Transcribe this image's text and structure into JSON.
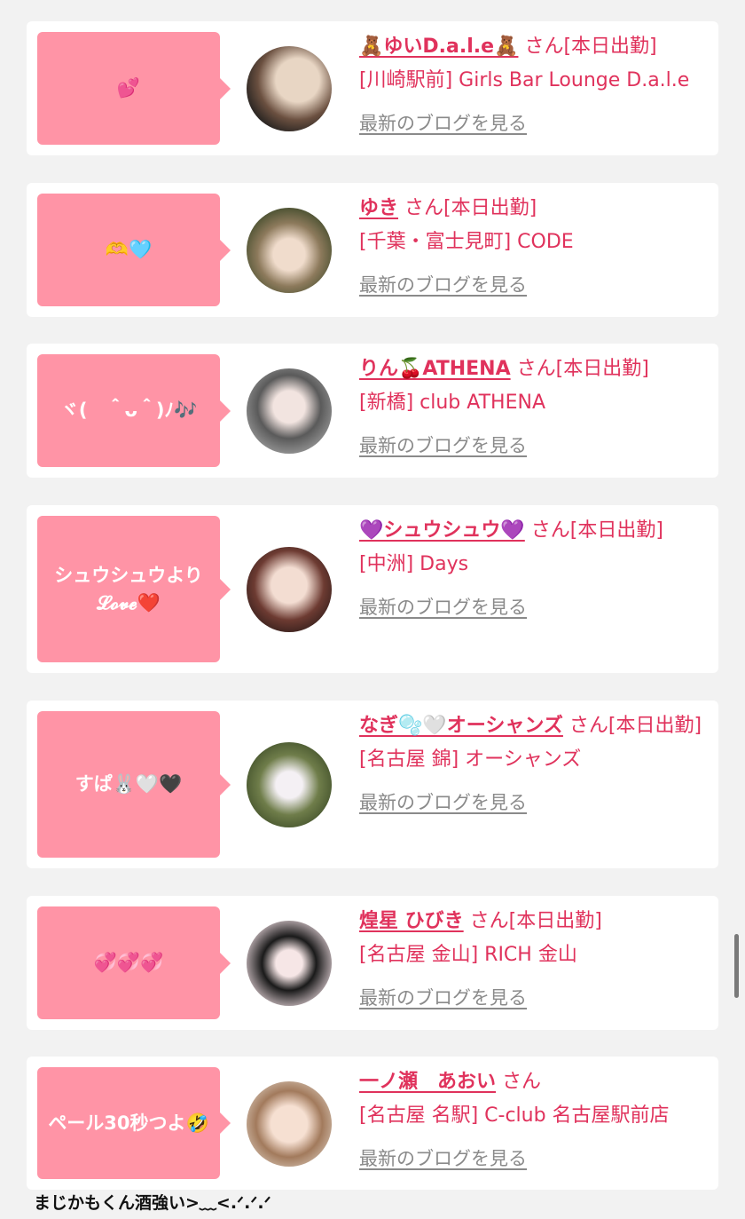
{
  "cards": [
    {
      "bubble": "💕",
      "name": "🧸ゆいD.a.l.e🧸",
      "san": "さん[本日出勤]",
      "shop": "[川崎駅前] Girls Bar Lounge D.a.l.e",
      "blog": "最新のブログを見る"
    },
    {
      "bubble": "🫶🩵",
      "name": "ゆき",
      "san": "さん[本日出勤]",
      "shop": "[千葉・富士見町] CODE",
      "blog": "最新のブログを見る"
    },
    {
      "bubble": "ヾ(　＾ᴗ＾)ﾉ🎶",
      "name": "りん🍒ATHENA",
      "san": "さん[本日出勤]",
      "shop": "[新橋] club ATHENA",
      "blog": "最新のブログを見る"
    },
    {
      "bubble": "シュウシュウより𝓛𝓸𝓿𝓮❤️",
      "name": "💜シュウシュウ💜",
      "san": "さん[本日出勤]",
      "shop": "[中洲] Days",
      "blog": "最新のブログを見る"
    },
    {
      "bubble": "すぱ🐰🤍🖤",
      "name": "なぎ🫧🤍オーシャンズ",
      "san": "さん[本日出勤]",
      "shop": "[名古屋 錦] オーシャンズ",
      "blog": "最新のブログを見る"
    },
    {
      "bubble": "💞💞💞",
      "name": "煌星 ひびき",
      "san": "さん[本日出勤]",
      "shop": "[名古屋 金山] RICH 金山",
      "blog": "最新のブログを見る"
    },
    {
      "bubble": "ペール30秒つよ🤣",
      "name": "一ノ瀬　あおい",
      "san": "さん",
      "shop": "[名古屋 名駅] C-club 名古屋駅前店",
      "blog": "最新のブログを見る"
    }
  ],
  "caption": "まじかもくん酒強い>﹏<.ᐟ.ᐟ.ᐟ",
  "colors": {
    "accent": "#e0325c",
    "bubble": "#ff94a6",
    "link_gray": "#8a8a8a"
  }
}
